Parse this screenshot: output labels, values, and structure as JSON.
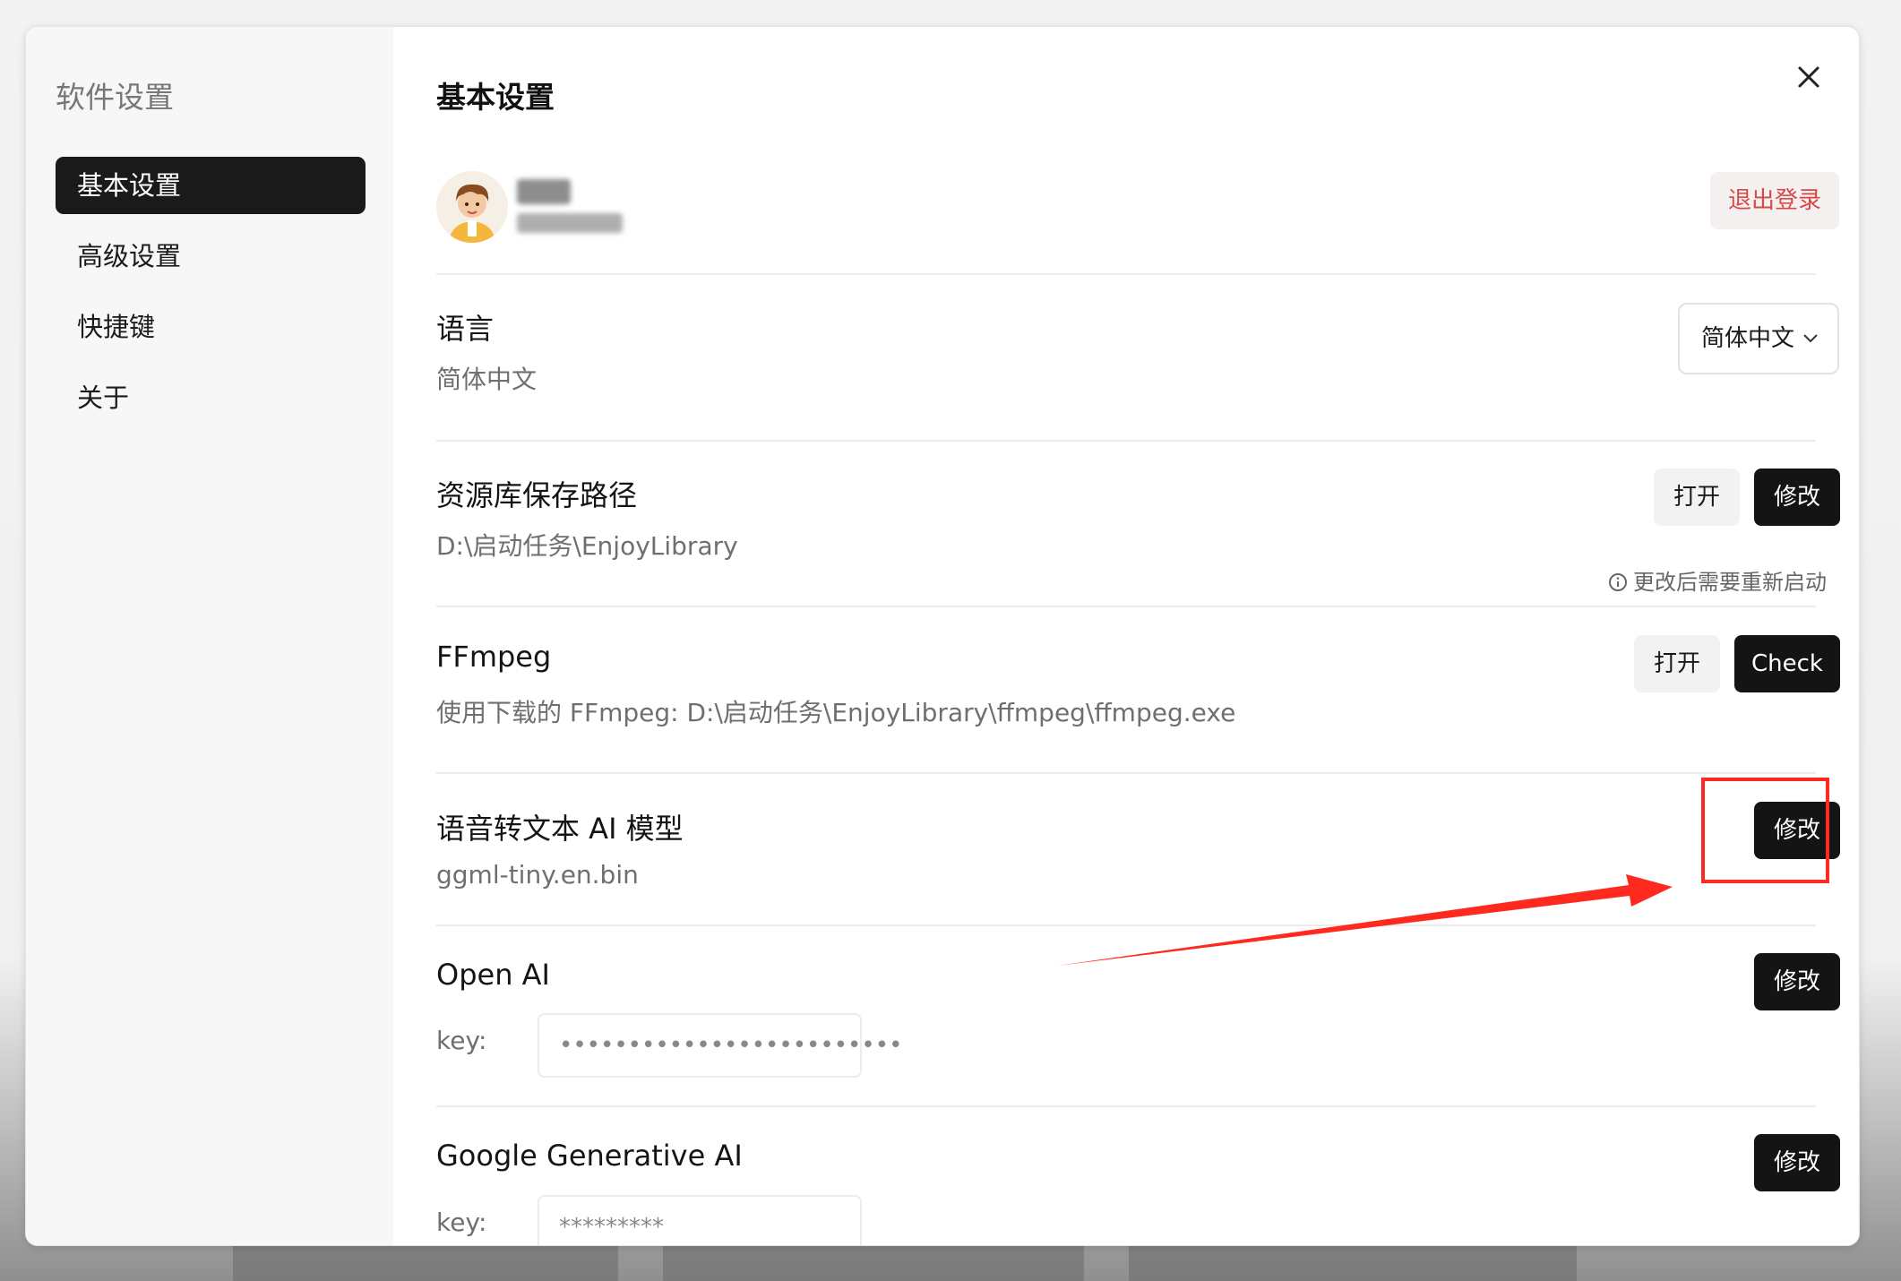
{
  "sidebar": {
    "title": "软件设置",
    "items": [
      {
        "label": "基本设置",
        "active": true
      },
      {
        "label": "高级设置",
        "active": false
      },
      {
        "label": "快捷键",
        "active": false
      },
      {
        "label": "关于",
        "active": false
      }
    ]
  },
  "main": {
    "title": "基本设置",
    "close_icon": "close-icon",
    "account": {
      "avatar_icon": "user-avatar",
      "logout_label": "退出登录"
    },
    "language": {
      "title": "语言",
      "value": "简体中文",
      "select_value": "简体中文"
    },
    "library": {
      "title": "资源库保存路径",
      "value": "D:\\启动任务\\EnjoyLibrary",
      "open_label": "打开",
      "modify_label": "修改",
      "hint": "更改后需要重新启动"
    },
    "ffmpeg": {
      "title": "FFmpeg",
      "value": "使用下载的 FFmpeg: D:\\启动任务\\EnjoyLibrary\\ffmpeg\\ffmpeg.exe",
      "open_label": "打开",
      "check_label": "Check"
    },
    "stt": {
      "title": "语音转文本 AI 模型",
      "value": "ggml-tiny.en.bin",
      "modify_label": "修改"
    },
    "openai": {
      "title": "Open AI",
      "key_label": "key:",
      "key_value": "•••••••••••••••••••••••••",
      "modify_label": "修改"
    },
    "google": {
      "title": "Google Generative AI",
      "key_label": "key:",
      "key_value": "*********",
      "modify_label": "修改"
    }
  },
  "colors": {
    "accent_dark": "#141414",
    "logout_red": "#d94848",
    "annotation_red": "#ff2a1f"
  }
}
